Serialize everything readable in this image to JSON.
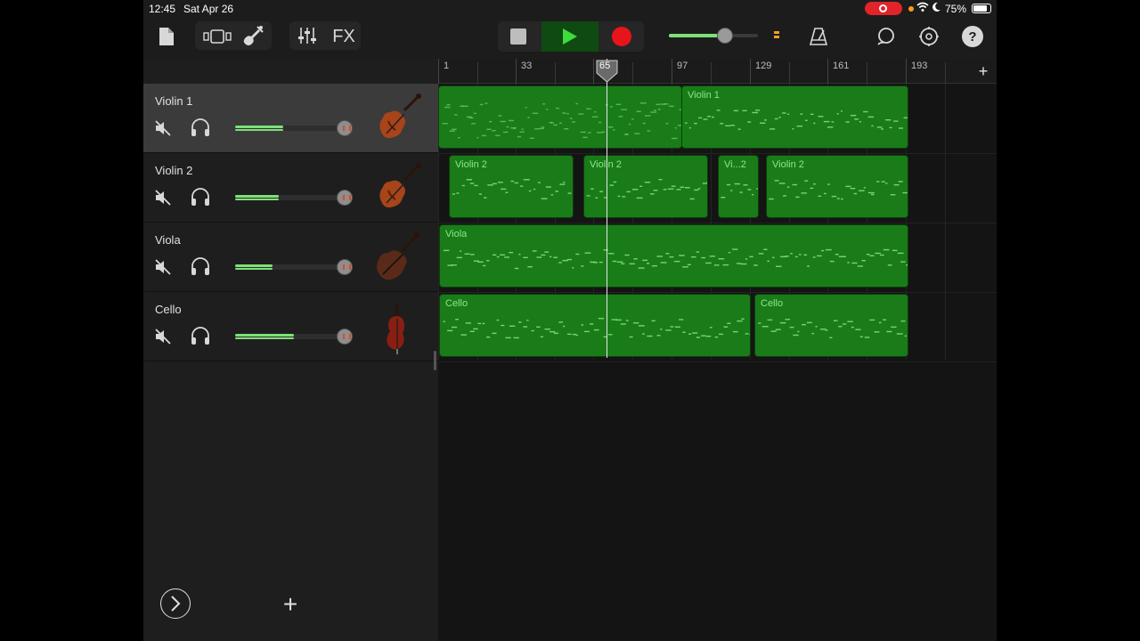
{
  "status_bar": {
    "time": "12:45",
    "date": "Sat Apr 26",
    "battery_percent": "75%"
  },
  "toolbar": {
    "fx_label": "FX",
    "icons": [
      "document-icon",
      "browser-icon",
      "instrument-icon",
      "mixer-icon",
      "stop-icon",
      "play-icon",
      "record-icon",
      "metronome-icon",
      "loop-icon",
      "settings-icon",
      "help-icon"
    ],
    "help_label": "?",
    "master_volume": 0.62
  },
  "timeline": {
    "bar_labels": [
      "1",
      "33",
      "65",
      "97",
      "129",
      "161",
      "193"
    ],
    "playhead_bar": "65"
  },
  "tracks": [
    {
      "name": "Violin 1",
      "instrument": "violin",
      "volume": 0.43,
      "selected": true
    },
    {
      "name": "Violin 2",
      "instrument": "violin",
      "volume": 0.39,
      "selected": false
    },
    {
      "name": "Viola",
      "instrument": "viola",
      "volume": 0.33,
      "selected": false
    },
    {
      "name": "Cello",
      "instrument": "cello",
      "volume": 0.52,
      "selected": false
    }
  ],
  "regions": [
    {
      "track": 0,
      "label": ""
    },
    {
      "track": 0,
      "label": "Violin 1"
    },
    {
      "track": 1,
      "label": "Violin 2"
    },
    {
      "track": 1,
      "label": "Violin 2"
    },
    {
      "track": 1,
      "label": "Vi...2"
    },
    {
      "track": 1,
      "label": "Violin 2"
    },
    {
      "track": 2,
      "label": "Viola"
    },
    {
      "track": 3,
      "label": "Cello"
    },
    {
      "track": 3,
      "label": "Cello"
    }
  ],
  "bottom": {
    "add_label": "+"
  },
  "colors": {
    "region_green": "#197c19",
    "note_green": "#7ee07a",
    "record_red": "#e8141c",
    "play_green": "#3ddc3d"
  }
}
